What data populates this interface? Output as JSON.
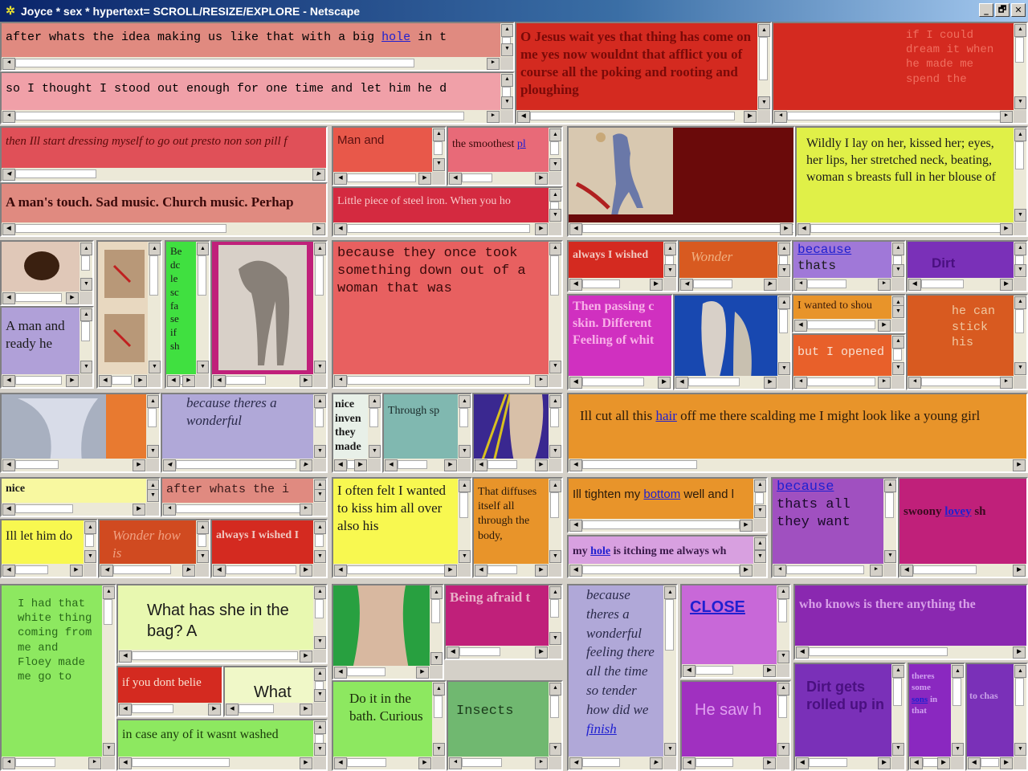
{
  "window": {
    "title": "Joyce * sex * hypertext= SCROLL/RESIZE/EXPLORE - Netscape",
    "minimize": "_",
    "maximize": "🗗",
    "close": "✕"
  },
  "frames": {
    "f1": "after whats the idea making us like that with a big",
    "f1_link": "hole",
    "f1_tail": " in t",
    "f2": "so I thought I stood out enough for one time and let him he d",
    "f3": "O Jesus wait yes that thing has come on me yes now wouldnt that afflict you of course all the poking and rooting and ploughing",
    "f4": "if I could dream it when he made me spend the",
    "f5": "then Ill start dressing myself to go out presto non son pill f",
    "f6": "A man's touch. Sad music. Church music. Perhap",
    "f7": "Man and",
    "f8": "the smoothest",
    "f8_link": "pl",
    "f9": "Little piece of steel iron. When you ho",
    "f11": "Wildly I lay on her, kissed her; eyes, her lips, her stretched neck, beating, woman s breasts full in her blouse of",
    "f13": "A man and ready he",
    "f15": "Be dc le sc fa se if sh",
    "f17": "because they once took something down out of a woman that was",
    "f18": "always I wished",
    "f19": "Wonder",
    "f20": "because",
    "f20b": "thats",
    "f21": "Dirt",
    "f22": "Then passing c skin. Different Feeling of whit",
    "f24": "I wanted to shou",
    "f25": "but I opened i",
    "f26": "he can stick his",
    "f28": "because theres a wonderful",
    "f29": "nice inven they made",
    "f30": "Through sp",
    "f32": "Ill cut all this",
    "f32_link": "hair",
    "f32_tail": " off me there scalding me I might look like a young girl",
    "f33": "nice",
    "f34": "after whats the i",
    "f35": "Ill let him do",
    "f36": "Wonder how is",
    "f37": "always I wished I",
    "f38": "I often felt I wanted to kiss him all over also his",
    "f39": "That diffuses itself all through the body,",
    "f40": "Ill tighten my",
    "f40_link": "bottom",
    "f40_tail": " well and l",
    "f41": "my",
    "f41_link": "hole",
    "f41_tail": " is itching me always wh",
    "f42": "because",
    "f42b": "thats all they want",
    "f43": "swoony",
    "f43_link": "lovey",
    "f43_tail": " sh",
    "f44": "I had that white thing coming from me and Floey made me go to",
    "f45": "What has she in the bag? A",
    "f46": "if you dont belie",
    "f47": "What",
    "f48": "in case any of it wasnt washed",
    "f50": "Being afraid t",
    "f51": "Do it in the bath. Curious",
    "f52": "Insects",
    "f53": "because theres a wonderful feeling there all the time so tender how did we",
    "f53_link": "finish",
    "f54": "CLOSE",
    "f55": "who knows is there anything the",
    "f56": "He saw h",
    "f57": "Dirt gets rolled up in",
    "f58": "theres some",
    "f58_link": "sons",
    "f58_tail": " in that",
    "f59": "to chas"
  },
  "colors": {
    "salmon": "#e08a80",
    "red": "#d42a20",
    "darkred": "#8a1010",
    "orange": "#e8942a",
    "yellow": "#f8f850",
    "green": "#8de860",
    "purple": "#7a30b8",
    "magenta": "#c0208a",
    "lavender": "#b0a8d8",
    "teal": "#80b8b0"
  }
}
